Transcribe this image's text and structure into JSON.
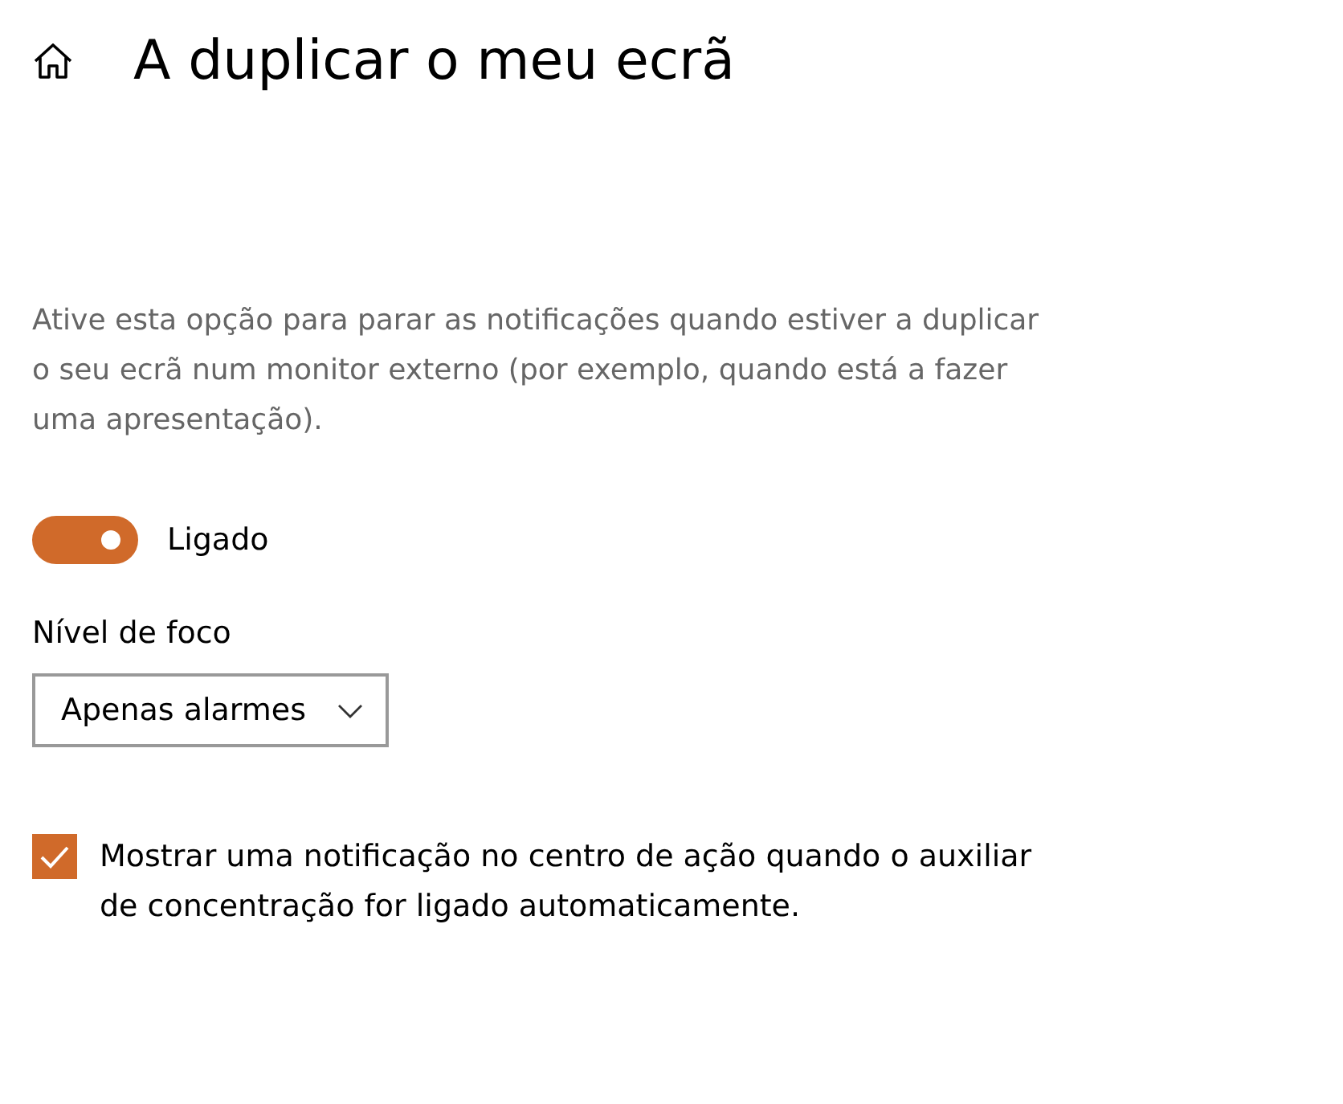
{
  "header": {
    "title": "A duplicar o meu ecrã"
  },
  "description": "Ative esta opção para parar as notificações quando estiver a duplicar o seu ecrã num monitor externo (por exemplo, quando está a fazer uma apresentação).",
  "toggle": {
    "on": true,
    "label": "Ligado"
  },
  "focus_level": {
    "label": "Nível de foco",
    "value": "Apenas alarmes"
  },
  "notification_option": {
    "checked": true,
    "label": "Mostrar uma notificação no centro de ação quando o auxiliar de concentração for ligado automaticamente."
  }
}
